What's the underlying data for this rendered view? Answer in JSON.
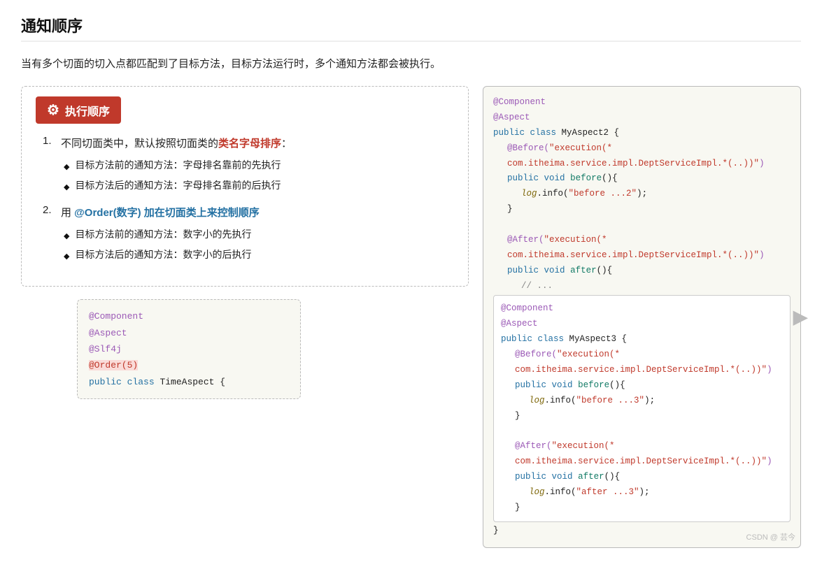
{
  "page": {
    "title": "通知顺序",
    "intro": "当有多个切面的切入点都匹配到了目标方法，目标方法运行时，多个通知方法都会被执行。",
    "exec_header_icon": "⚙",
    "exec_header_label": "执行顺序"
  },
  "left_list": {
    "items": [
      {
        "num": "1.",
        "text_before": "不同切面类中，默认按照切面类的",
        "highlight": "类名字母排序",
        "highlight_class": "highlight-red",
        "text_after": "：",
        "sub_items": [
          "目标方法前的通知方法：字母排名靠前的先执行",
          "目标方法后的通知方法：字母排名靠前的后执行"
        ]
      },
      {
        "num": "2.",
        "text_before": "用 ",
        "highlight": "@Order(数字) 加在切面类上来控制顺序",
        "highlight_class": "highlight-blue",
        "text_after": "",
        "sub_items": [
          "目标方法前的通知方法：数字小的先执行",
          "目标方法后的通知方法：数字小的后执行"
        ]
      }
    ]
  },
  "code_small": {
    "lines": [
      {
        "type": "annotation",
        "text": "@Component"
      },
      {
        "type": "annotation",
        "text": "@Aspect"
      },
      {
        "type": "annotation",
        "text": "@Slf4j"
      },
      {
        "type": "order-highlight",
        "text": "@Order(5)"
      },
      {
        "type": "normal",
        "text": "public class TimeAspect {"
      }
    ]
  },
  "code_right": {
    "outer": {
      "lines_top": [
        {
          "type": "annotation",
          "text": "@Component"
        },
        {
          "type": "annotation",
          "text": "@Aspect"
        },
        {
          "type": "normal",
          "text": "public class MyAspect2 {"
        },
        {
          "type": "indent1-annotation",
          "text": "@Before(\"execution(* com.itheima.service.impl.DeptServiceImpl.*(..))\")"
        },
        {
          "type": "indent1-normal",
          "text": "public void before(){"
        },
        {
          "type": "indent2-log",
          "text": "log.info(\"before ...2\");"
        },
        {
          "type": "indent1-close",
          "text": "}"
        },
        {
          "type": "blank",
          "text": ""
        },
        {
          "type": "indent1-annotation",
          "text": "@After(\"execution(* com.itheima.service.impl.DeptServiceImpl.*(..))\")"
        },
        {
          "type": "indent1-normal",
          "text": "public void after(){"
        },
        {
          "type": "indent2-comment",
          "text": "// ..."
        }
      ]
    },
    "inner": {
      "lines": [
        {
          "type": "annotation",
          "text": "@Component"
        },
        {
          "type": "annotation",
          "text": "@Aspect"
        },
        {
          "type": "normal",
          "text": "public class MyAspect3 {"
        },
        {
          "type": "indent1-annotation",
          "text": "@Before(\"execution(* com.itheima.service.impl.DeptServiceImpl.*(..))\")"
        },
        {
          "type": "indent1-normal",
          "text": "public void before(){"
        },
        {
          "type": "indent2-log",
          "text": "log.info(\"before ...3\");"
        },
        {
          "type": "indent1-close",
          "text": "}"
        },
        {
          "type": "blank",
          "text": ""
        },
        {
          "type": "indent1-annotation",
          "text": "@After(\"execution(* com.itheima.service.impl.DeptServiceImpl.*(..))\")"
        },
        {
          "type": "indent1-normal",
          "text": "public void after(){"
        },
        {
          "type": "indent2-log",
          "text": "log.info(\"after ...3\");"
        },
        {
          "type": "indent1-close",
          "text": "}"
        }
      ]
    }
  },
  "watermark": "CSDN @ 芸今"
}
